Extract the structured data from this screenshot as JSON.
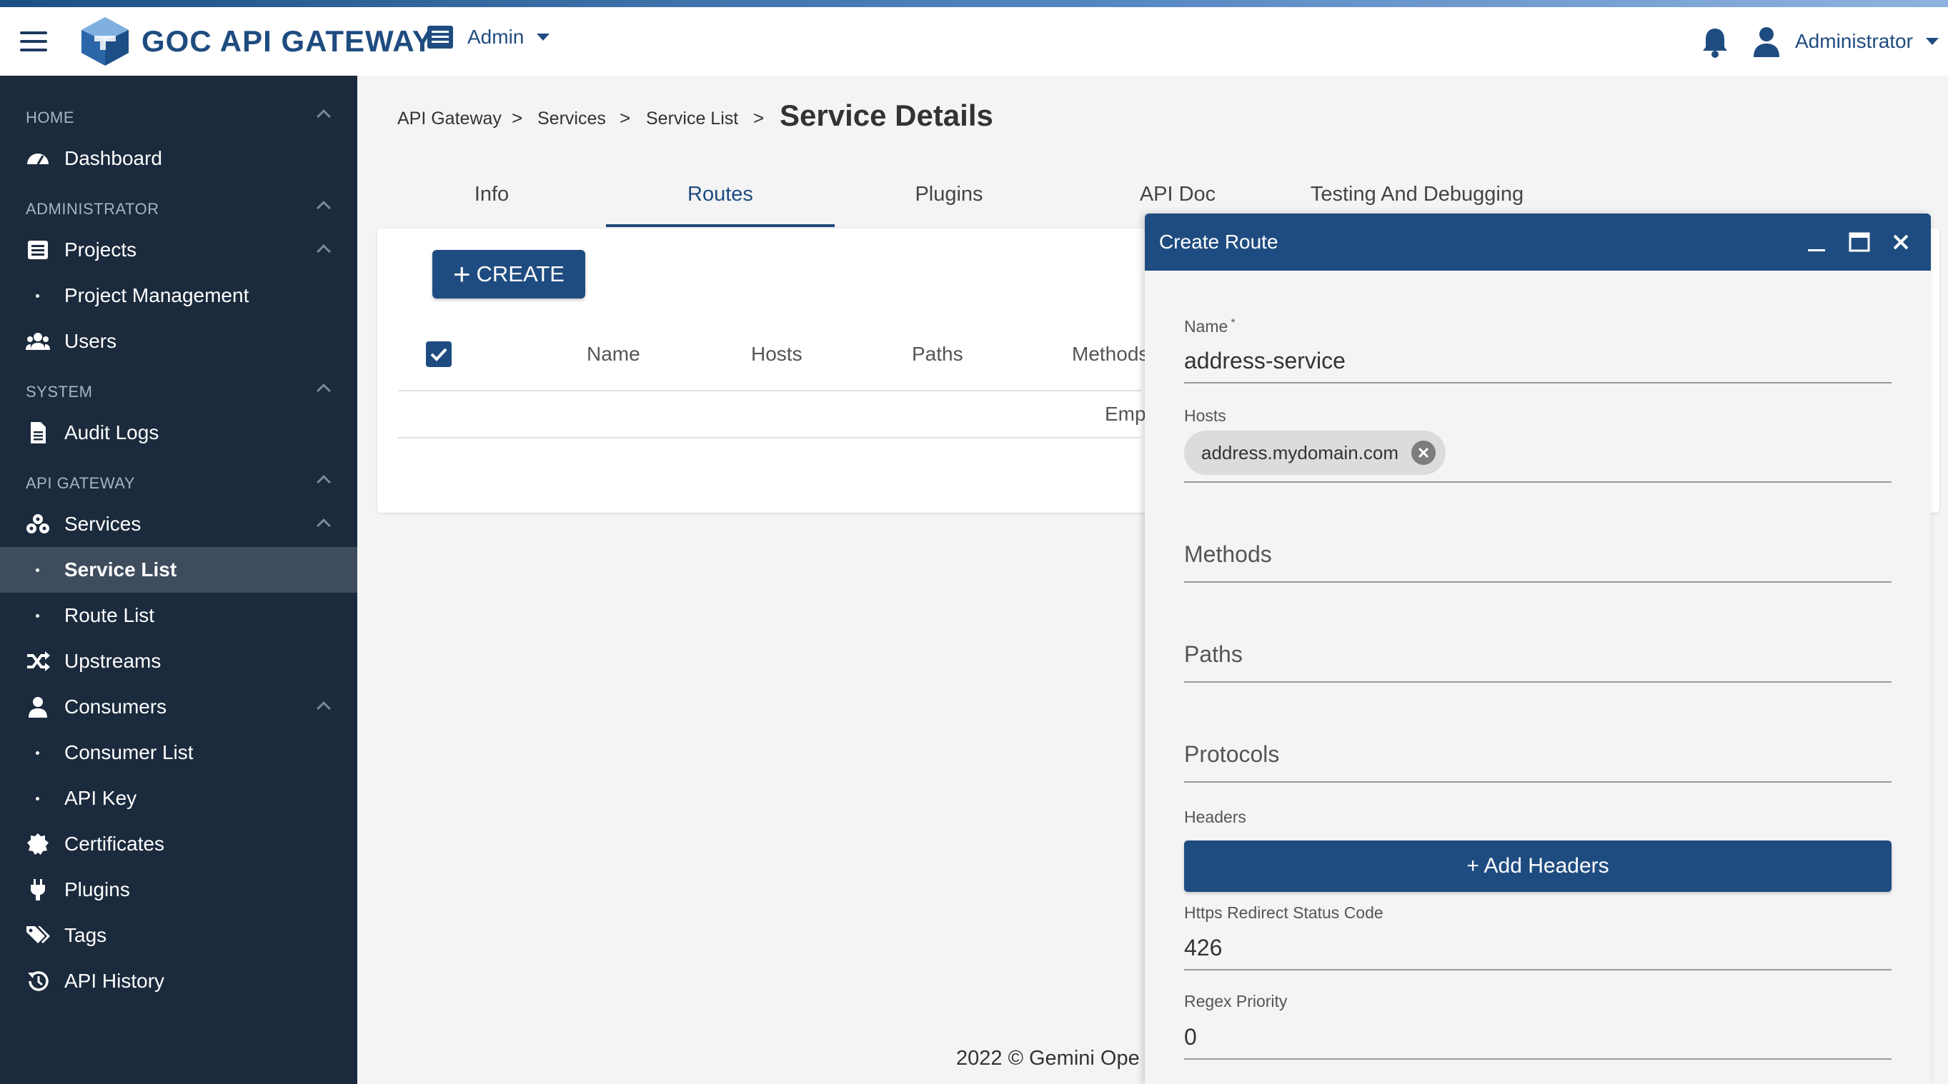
{
  "header": {
    "brand": "GOC API GATEWAY",
    "role_switch": "Admin",
    "user": "Administrator"
  },
  "sidebar": {
    "sections": [
      "HOME",
      "ADMINISTRATOR",
      "SYSTEM",
      "API GATEWAY"
    ],
    "items": [
      {
        "label": "Dashboard",
        "icon": "dashboard-icon"
      },
      {
        "label": "Projects",
        "icon": "list-icon"
      },
      {
        "label": "Project Management",
        "icon": "dot"
      },
      {
        "label": "Users",
        "icon": "users-icon"
      },
      {
        "label": "Audit Logs",
        "icon": "document-icon"
      },
      {
        "label": "Services",
        "icon": "services-icon"
      },
      {
        "label": "Service List",
        "icon": "dot",
        "active": true
      },
      {
        "label": "Route List",
        "icon": "dot"
      },
      {
        "label": "Upstreams",
        "icon": "shuffle-icon"
      },
      {
        "label": "Consumers",
        "icon": "user-icon"
      },
      {
        "label": "Consumer List",
        "icon": "dot"
      },
      {
        "label": "API Key",
        "icon": "dot"
      },
      {
        "label": "Certificates",
        "icon": "certificate-icon"
      },
      {
        "label": "Plugins",
        "icon": "plug-icon"
      },
      {
        "label": "Tags",
        "icon": "tags-icon"
      },
      {
        "label": "API History",
        "icon": "history-icon"
      }
    ]
  },
  "breadcrumb": [
    "API Gateway",
    "Services",
    "Service List"
  ],
  "breadcrumb_sep": ">",
  "page_title": "Service Details",
  "tabs": [
    "Info",
    "Routes",
    "Plugins",
    "API Doc",
    "Testing And Debugging"
  ],
  "active_tab": "Routes",
  "toolbar": {
    "create_label": "CREATE"
  },
  "table": {
    "columns": [
      "Name",
      "Hosts",
      "Paths",
      "Methods"
    ],
    "empty_text": "Emp"
  },
  "footer": "2022 © Gemini Ope",
  "dialog": {
    "title": "Create Route",
    "name_label": "Name",
    "name_required": "*",
    "name_value": "address-service",
    "hosts_label": "Hosts",
    "hosts": [
      "address.mydomain.com"
    ],
    "methods_placeholder": "Methods",
    "paths_placeholder": "Paths",
    "protocols_placeholder": "Protocols",
    "headers_label": "Headers",
    "add_headers_label": "+ Add Headers",
    "redirect_label": "Https Redirect Status Code",
    "redirect_value": "426",
    "regex_label": "Regex Priority",
    "regex_value": "0"
  },
  "colors": {
    "primary": "#1f4c80",
    "sidebar": "#1b2a3c",
    "sidebar_active": "#3e4c5e"
  }
}
